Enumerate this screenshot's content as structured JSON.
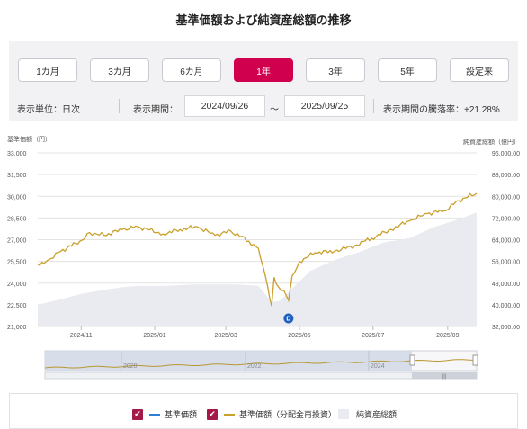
{
  "title": "基準価額および純資産総額の推移",
  "periods": [
    "1カ月",
    "3カ月",
    "6カ月",
    "1年",
    "3年",
    "5年",
    "設定来"
  ],
  "active_period": "1年",
  "unit_label": "表示単位：日次",
  "range_label": "表示期間：",
  "start_date": "2024/09/26",
  "tilde": "～",
  "end_date": "2025/09/25",
  "change_label": "表示期間の騰落率：+21.28%",
  "legend": {
    "nav": "基準価額",
    "nav_reinvest": "基準価額（分配金再投資）",
    "aum": "純資産総額"
  },
  "colors": {
    "accent": "#d1004f",
    "checkbox": "#a3194a",
    "nav": "#2e7fd8",
    "nav_reinvest": "#c9a02a",
    "aum_fill": "#e9ebf0"
  },
  "chart_data": {
    "type": "line",
    "left_axis": {
      "title": "基準価額（円）",
      "ylim": [
        21000,
        33000
      ],
      "ticks": [
        "21,000",
        "22,500",
        "24,000",
        "25,500",
        "27,000",
        "28,500",
        "30,000",
        "31,500",
        "33,000"
      ]
    },
    "right_axis": {
      "title": "純資産総額（億円）",
      "ylim": [
        32000,
        96000
      ],
      "ticks": [
        "32,000.00",
        "40,000.00",
        "48,000.00",
        "56,000.00",
        "64,000.00",
        "72,000.00",
        "80,000.00",
        "88,000.00",
        "96,000.00"
      ]
    },
    "x_ticks": [
      "2024/11",
      "2025/01",
      "2025/03",
      "2025/05",
      "2025/07",
      "2025/09"
    ],
    "x_range": [
      "2024/09/26",
      "2025/09/25"
    ],
    "grid": true,
    "marker": {
      "label": "D",
      "date": "2025/04/22"
    },
    "series": [
      {
        "name": "基準価額（分配金再投資）",
        "x": [
          "2024/09/26",
          "2024/10/03",
          "2024/10/15",
          "2024/10/31",
          "2024/11/08",
          "2024/11/20",
          "2024/12/05",
          "2024/12/18",
          "2025/01/08",
          "2025/01/22",
          "2025/02/05",
          "2025/02/20",
          "2025/03/05",
          "2025/03/20",
          "2025/03/28",
          "2025/04/03",
          "2025/04/08",
          "2025/04/10",
          "2025/04/14",
          "2025/04/18",
          "2025/04/22",
          "2025/04/25",
          "2025/05/01",
          "2025/05/14",
          "2025/05/30",
          "2025/06/16",
          "2025/06/30",
          "2025/07/16",
          "2025/07/31",
          "2025/08/15",
          "2025/08/29",
          "2025/09/10",
          "2025/09/25"
        ],
        "values": [
          25300,
          25500,
          26200,
          26900,
          27500,
          27300,
          27700,
          27900,
          27400,
          27700,
          27900,
          27300,
          27600,
          26900,
          26400,
          24400,
          22400,
          24400,
          23700,
          23500,
          22800,
          24500,
          25500,
          26100,
          26200,
          26600,
          27100,
          27700,
          28300,
          28800,
          29000,
          29700,
          30200
        ]
      },
      {
        "name": "純資産総額",
        "x": [
          "2024/09/26",
          "2024/10/15",
          "2024/11/01",
          "2024/11/20",
          "2024/12/05",
          "2024/12/20",
          "2025/01/10",
          "2025/02/01",
          "2025/02/20",
          "2025/03/10",
          "2025/03/28",
          "2025/04/08",
          "2025/04/15",
          "2025/04/25",
          "2025/05/10",
          "2025/05/30",
          "2025/06/20",
          "2025/07/10",
          "2025/07/31",
          "2025/08/20",
          "2025/09/10",
          "2025/09/25"
        ],
        "values": [
          40000,
          42000,
          44000,
          45500,
          46500,
          47000,
          47000,
          47500,
          47500,
          47500,
          47000,
          41000,
          41500,
          46000,
          52500,
          56500,
          59500,
          63000,
          64500,
          68500,
          71500,
          74000
        ]
      }
    ]
  },
  "navigator": {
    "labels": [
      "2020",
      "2022",
      "2024"
    ]
  }
}
